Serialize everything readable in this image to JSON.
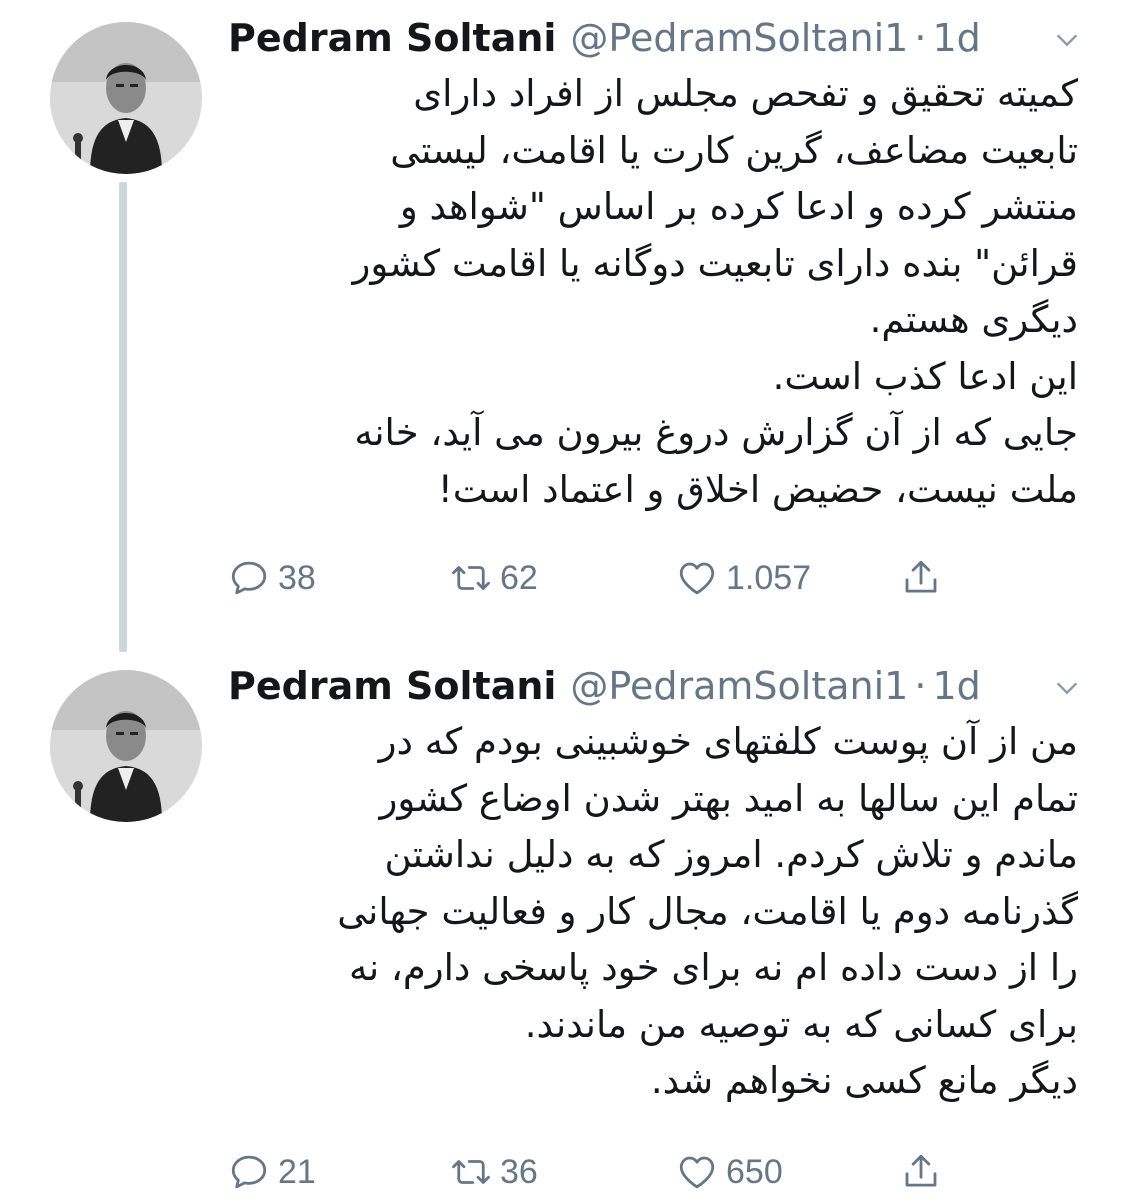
{
  "tweets": [
    {
      "name": "Pedram Soltani",
      "handle": "@PedramSoltani1",
      "separator": "·",
      "time": "1d",
      "text": "کمیته تحقیق و تفحص مجلس از افراد دارای\nتابعیت مضاعف، گرین کارت یا اقامت، لیستی\nمنتشر کرده و ادعا کرده بر اساس \"شواهد و\nقرائن\" بنده دارای تابعیت دوگانه یا اقامت کشور\nدیگری هستم.\nاین ادعا کذب است.\nجایی که از آن گزارش دروغ بیرون می آید، خانه\nملت نیست، حضیض اخلاق و اعتماد است!",
      "replies": "38",
      "retweets": "62",
      "likes": "1.057"
    },
    {
      "name": "Pedram Soltani",
      "handle": "@PedramSoltani1",
      "separator": "·",
      "time": "1d",
      "text": "من از آن پوست کلفتهای خوشبینی بودم که در\nتمام این سالها به امید بهتر شدن اوضاع کشور\nماندم و تلاش کردم. امروز که به دلیل نداشتن\nگذرنامه دوم یا اقامت، مجال کار و فعالیت جهانی\nرا از دست داده ام نه برای خود پاسخی دارم، نه\nبرای کسانی که به توصیه من ماندند.\nدیگر مانع کسی نخواهم شد.",
      "replies": "21",
      "retweets": "36",
      "likes": "650"
    }
  ],
  "icons": {
    "reply": "reply-icon",
    "retweet": "retweet-icon",
    "like": "like-icon",
    "share": "share-icon",
    "caret": "chevron-down-icon"
  },
  "colors": {
    "text": "#14171a",
    "secondary": "#657786",
    "thread_line": "#ccd6dd"
  }
}
